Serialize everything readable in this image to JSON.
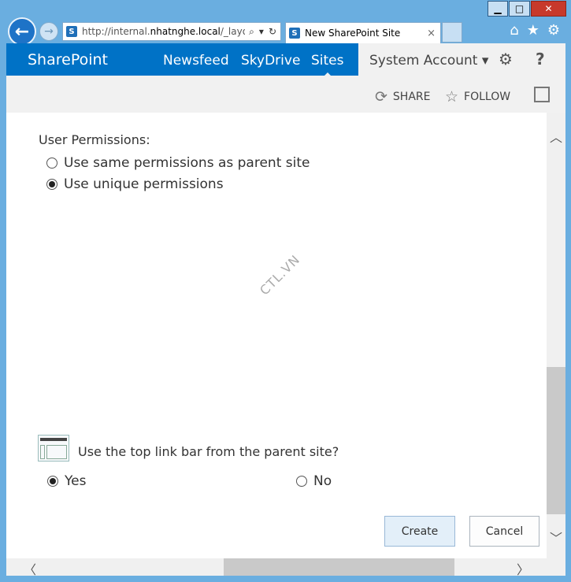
{
  "window": {
    "minimize": "▁",
    "maximize": "□",
    "close": "✕"
  },
  "browser": {
    "back_icon": "back-arrow-icon",
    "address_url_pre": "http://internal.",
    "address_url_host": "nhatnghe.local",
    "address_url_post": "/_layout",
    "address_tools": [
      "⌕",
      "▾",
      "↻"
    ],
    "tab_title": "New SharePoint Site",
    "tab_close": "×",
    "icons": [
      "⌂",
      "★",
      "⚙"
    ]
  },
  "sharepoint": {
    "brand": "SharePoint",
    "nav": [
      {
        "label": "Newsfeed"
      },
      {
        "label": "SkyDrive"
      },
      {
        "label": "Sites"
      }
    ],
    "account": "System Account",
    "account_caret": "▾",
    "gear": "⚙",
    "help": "?"
  },
  "subbar": {
    "share": "SHARE",
    "follow": "FOLLOW"
  },
  "content": {
    "permissions_label": "User Permissions:",
    "permissions_options": [
      {
        "label": "Use same permissions as parent site",
        "selected": false
      },
      {
        "label": "Use unique permissions",
        "selected": true
      }
    ],
    "watermark": "CTL.VN",
    "linkbar_label": "Use the top link bar from the parent site?",
    "linkbar_options": [
      {
        "label": "Yes",
        "selected": true
      },
      {
        "label": "No",
        "selected": false
      }
    ],
    "create_label": "Create",
    "cancel_label": "Cancel"
  },
  "scroll": {
    "up": "︿",
    "down": "﹀",
    "left": "〈",
    "right": "〉"
  }
}
